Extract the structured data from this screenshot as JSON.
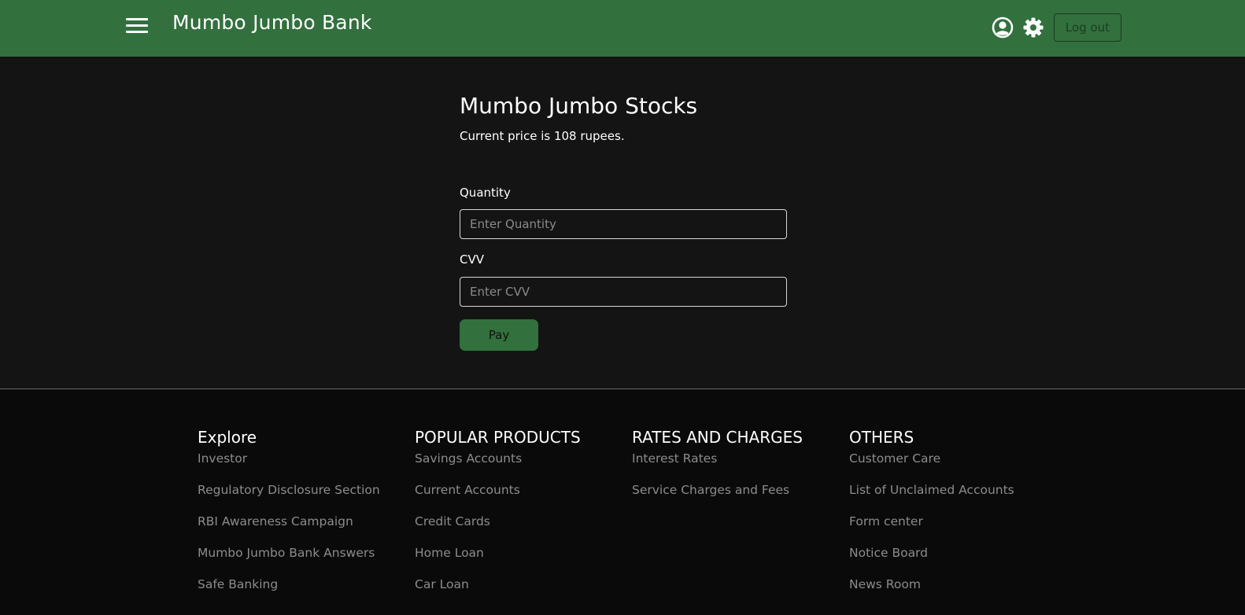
{
  "header": {
    "brand": "Mumbo Jumbo Bank",
    "logout_label": "Log out",
    "icons": [
      "menu-icon",
      "user-icon",
      "gear-icon"
    ]
  },
  "main": {
    "title": "Mumbo Jumbo Stocks",
    "price_text": "Current price is 108 rupees.",
    "quantity_label": "Quantity",
    "quantity_placeholder": "Enter Quantity",
    "cvv_label": "CVV",
    "cvv_placeholder": "Enter CVV",
    "pay_label": "Pay"
  },
  "footer": {
    "columns": [
      {
        "heading": "Explore",
        "links": [
          "Investor",
          "Regulatory Disclosure Section",
          "RBI Awareness Campaign",
          "Mumbo Jumbo Bank Answers",
          "Safe Banking"
        ]
      },
      {
        "heading": "POPULAR PRODUCTS",
        "links": [
          "Savings Accounts",
          "Current Accounts",
          "Credit Cards",
          "Home Loan",
          "Car Loan"
        ]
      },
      {
        "heading": "RATES AND CHARGES",
        "links": [
          "Interest Rates",
          "Service Charges and Fees"
        ]
      },
      {
        "heading": "OTHERS",
        "links": [
          "Customer Care",
          "List of Unclaimed Accounts",
          "Form center",
          "Notice Board",
          "News Room"
        ]
      }
    ]
  },
  "colors": {
    "brand_green": "#32703d",
    "background": "#141414",
    "footer_background": "#0a0a0a",
    "footer_link": "#8c8c8c"
  }
}
